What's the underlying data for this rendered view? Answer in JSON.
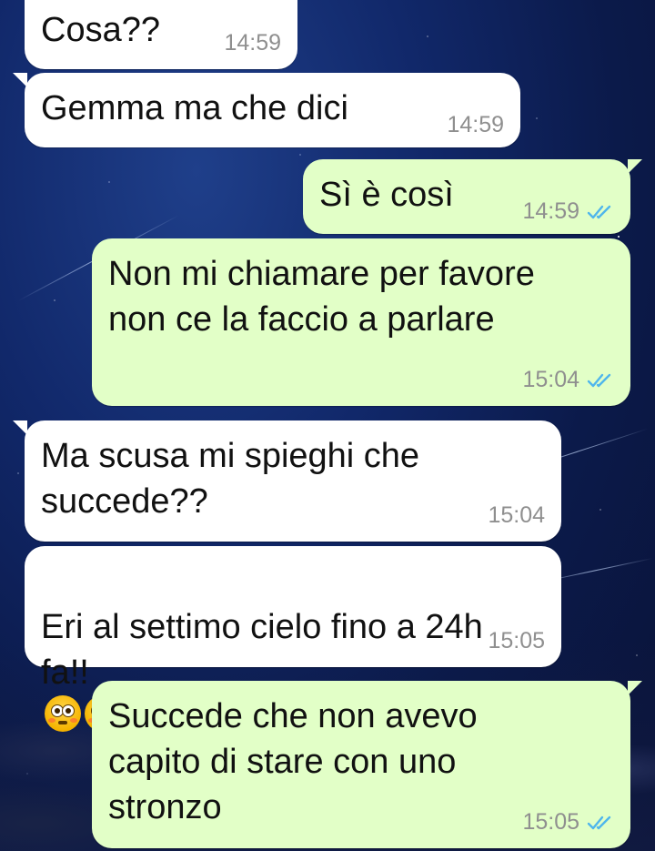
{
  "messages": [
    {
      "id": "m1",
      "direction": "in",
      "text": "Cosa??",
      "time": "14:59"
    },
    {
      "id": "m2",
      "direction": "in",
      "text": "Gemma ma che dici",
      "time": "14:59"
    },
    {
      "id": "m3",
      "direction": "out",
      "text": "Sì è così",
      "time": "14:59",
      "status": "read"
    },
    {
      "id": "m4",
      "direction": "out",
      "text": "Non mi chiamare per favore\nnon ce la faccio a parlare",
      "time": "15:04",
      "status": "read"
    },
    {
      "id": "m5",
      "direction": "in",
      "text": "Ma scusa mi spieghi che\nsuccede??",
      "time": "15:04"
    },
    {
      "id": "m6",
      "direction": "in",
      "text": "Eri al settimo cielo fino a 24h\nfa!!",
      "emoji": "flushed-face-emoji ×2",
      "time": "15:05"
    },
    {
      "id": "m7",
      "direction": "out",
      "text": "Succede che non avevo\ncapito di stare con uno\nstronzo",
      "time": "15:05",
      "status": "read"
    }
  ],
  "colors": {
    "incoming_bubble": "#ffffff",
    "outgoing_bubble": "#e2ffc7",
    "timestamp": "#8f8f8f",
    "read_ticks": "#4fb6ec",
    "wallpaper": "#11286a"
  },
  "icons": {
    "read_receipt": "double-check-icon",
    "emoji": "flushed-face-emoji"
  }
}
